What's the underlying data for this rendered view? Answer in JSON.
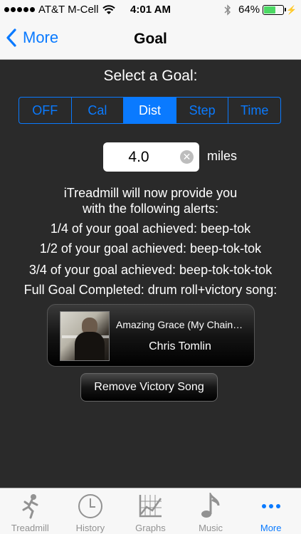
{
  "status_bar": {
    "carrier": "AT&T M-Cell",
    "time": "4:01 AM",
    "battery_percent": "64%",
    "battery_level": 0.64
  },
  "nav": {
    "back_label": "More",
    "title": "Goal"
  },
  "goal": {
    "select_title": "Select a Goal:",
    "segments": [
      "OFF",
      "Cal",
      "Dist",
      "Step",
      "Time"
    ],
    "selected": "Dist",
    "value": "4.0",
    "unit": "miles"
  },
  "alerts": {
    "intro_line1": "iTreadmill will now provide you",
    "intro_line2": "with the following alerts:",
    "quarter": "1/4 of your goal achieved: beep-tok",
    "half": "1/2 of your goal achieved: beep-tok-tok",
    "three_quarter": "3/4 of your goal achieved: beep-tok-tok-tok",
    "complete": "Full Goal Completed: drum roll+victory song:"
  },
  "victory_song": {
    "title": "Amazing Grace (My Chains Are Gone)",
    "artist": "Chris Tomlin",
    "remove_label": "Remove Victory Song"
  },
  "tab_bar": {
    "items": [
      {
        "label": "Treadmill",
        "icon": "runner-icon"
      },
      {
        "label": "History",
        "icon": "clock-icon"
      },
      {
        "label": "Graphs",
        "icon": "graph-icon"
      },
      {
        "label": "Music",
        "icon": "music-note-icon"
      },
      {
        "label": "More",
        "icon": "more-dots-icon"
      }
    ],
    "active": "More"
  },
  "colors": {
    "accent": "#0a7aff",
    "background": "#2a2a2a",
    "battery_fill": "#4cd964"
  }
}
